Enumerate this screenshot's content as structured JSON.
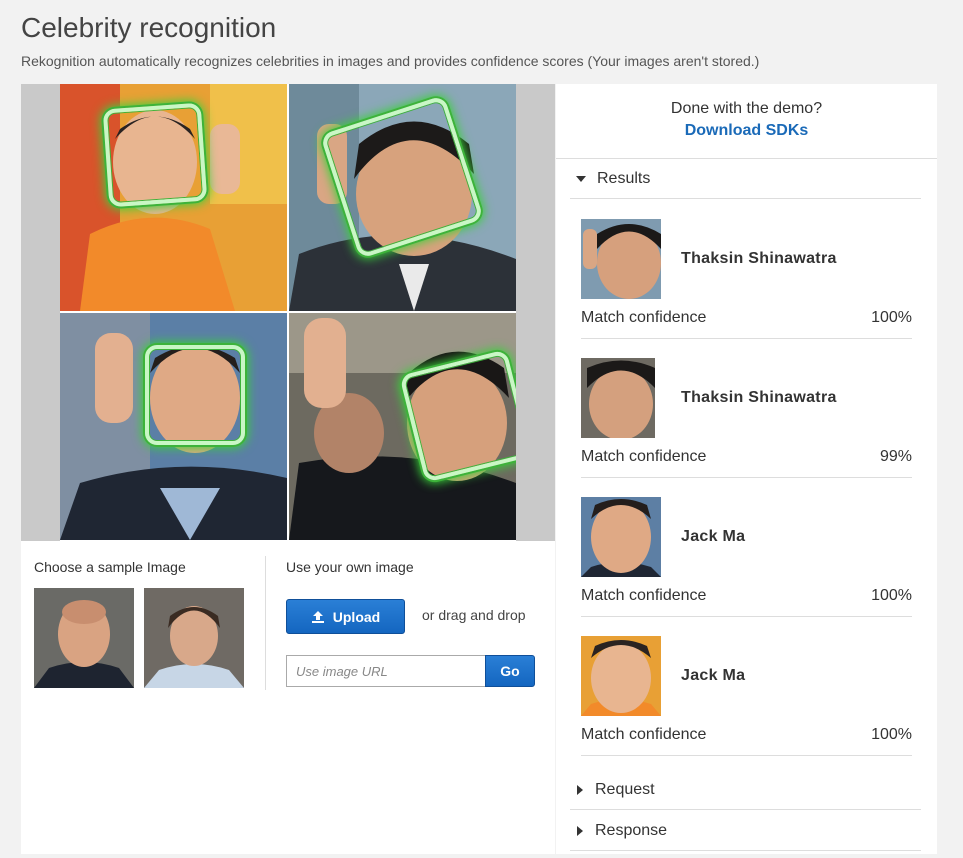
{
  "header": {
    "title": "Celebrity recognition",
    "subtitle": "Rekognition automatically recognizes celebrities in images and provides confidence scores (Your images aren't stored.)"
  },
  "samples": {
    "label": "Choose a sample Image",
    "thumbnails": [
      "sample-portrait-1",
      "sample-portrait-2"
    ]
  },
  "own_image": {
    "label": "Use your own image",
    "upload_label": "Upload",
    "drag_text": "or drag and drop",
    "url_placeholder": "Use image URL",
    "go_label": "Go"
  },
  "demo": {
    "question": "Done with the demo?",
    "download_label": "Download SDKs"
  },
  "results": {
    "header": "Results",
    "items": [
      {
        "name": "Thaksin Shinawatra",
        "match_label": "Match confidence",
        "confidence": "100%"
      },
      {
        "name": "Thaksin Shinawatra",
        "match_label": "Match confidence",
        "confidence": "99%"
      },
      {
        "name": "Jack Ma",
        "match_label": "Match confidence",
        "confidence": "100%"
      },
      {
        "name": "Jack Ma",
        "match_label": "Match confidence",
        "confidence": "100%"
      }
    ]
  },
  "request": {
    "header": "Request"
  },
  "response": {
    "header": "Response"
  },
  "colors": {
    "accent": "#1a6ab8",
    "button": "#1466c0",
    "face_box": "#3db33a"
  }
}
